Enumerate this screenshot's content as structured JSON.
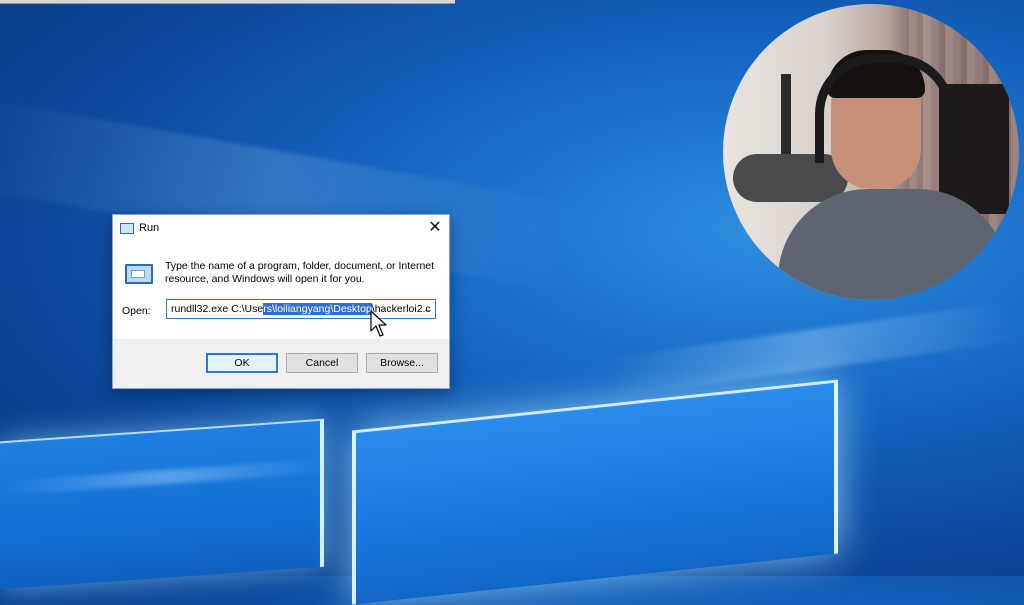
{
  "desktop": {
    "background_color": "#1667c4"
  },
  "run_dialog": {
    "title": "Run",
    "description": "Type the name of a program, folder, document, or Internet resource, and Windows will open it for you.",
    "open_label": "Open:",
    "command_before_selection": "rundll32.exe C:\\Use",
    "command_selected": "rs\\loiliangyang\\Desktop",
    "command_after_selection": "\\hackerloi2.c",
    "buttons": {
      "ok": "OK",
      "cancel": "Cancel",
      "browse": "Browse..."
    },
    "close_glyph": "✕",
    "dropdown_glyph": "⌄"
  },
  "webcam": {
    "shape": "circle"
  }
}
